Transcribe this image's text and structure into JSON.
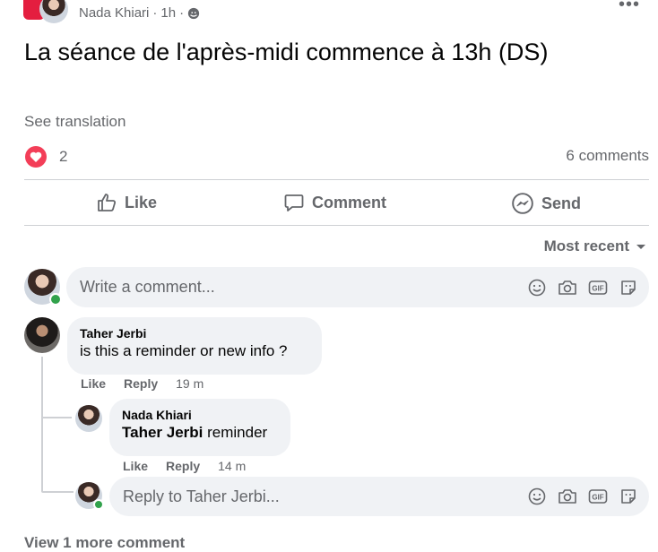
{
  "post": {
    "author": "Nada Khiari",
    "time": "1h",
    "separator": "·",
    "text": "La séance de l'après-midi commence à 13h (DS)",
    "see_translation": "See translation",
    "reaction_count": "2",
    "comments_count": "6 comments"
  },
  "actions": {
    "like": "Like",
    "comment": "Comment",
    "send": "Send"
  },
  "sort": {
    "label": "Most recent"
  },
  "composer": {
    "placeholder": "Write a comment..."
  },
  "comments": [
    {
      "author": "Taher Jerbi",
      "text": "is this a reminder or new info ?",
      "like": "Like",
      "reply": "Reply",
      "time": "19 m"
    }
  ],
  "reply": {
    "author": "Nada Khiari",
    "mention": "Taher Jerbi",
    "text": "reminder",
    "like": "Like",
    "reply": "Reply",
    "time": "14 m"
  },
  "reply_composer": {
    "placeholder": "Reply to Taher Jerbi..."
  },
  "view_more": "View 1 more comment",
  "colors": {
    "reaction": "#f33e58",
    "online": "#31a24c",
    "muted": "#65676b"
  }
}
